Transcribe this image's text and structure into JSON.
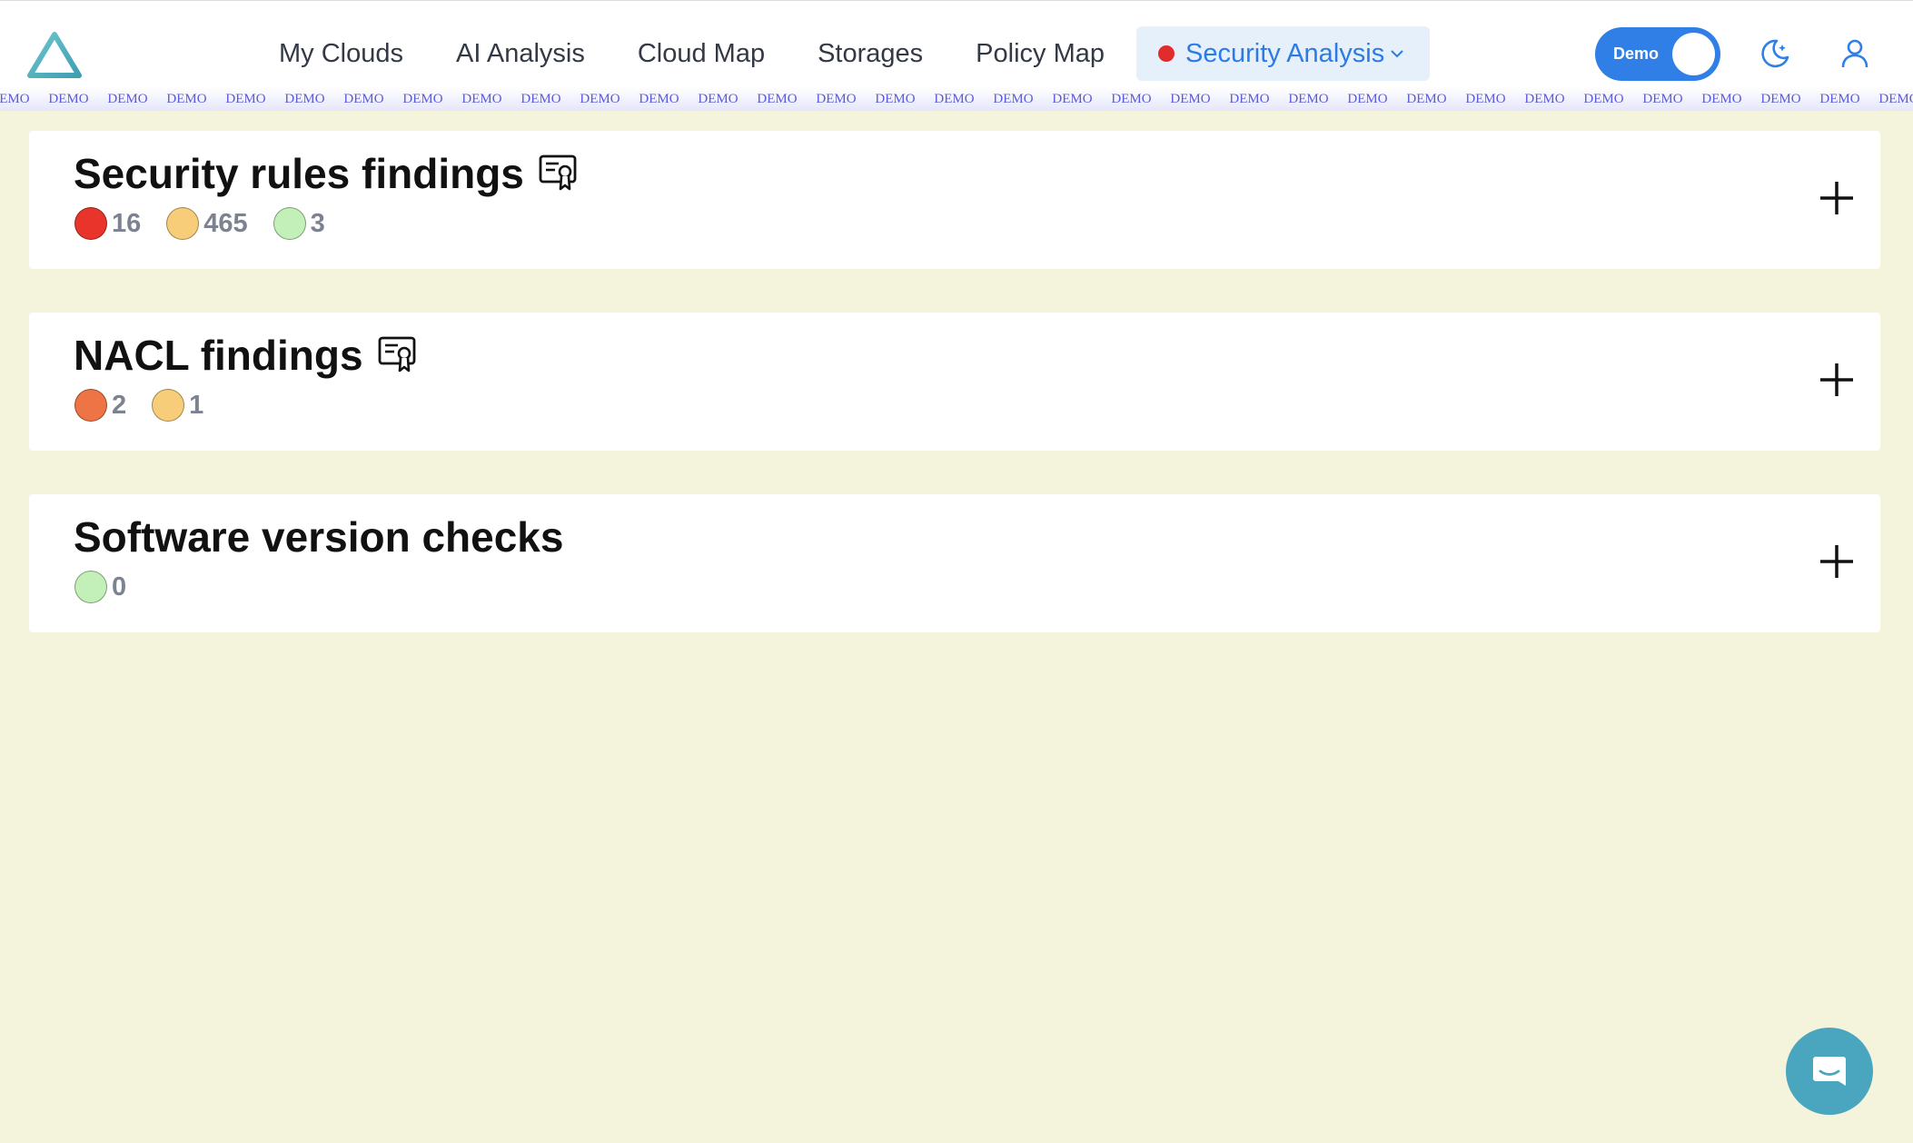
{
  "nav": {
    "items": [
      "My Clouds",
      "AI Analysis",
      "Cloud Map",
      "Storages",
      "Policy Map"
    ],
    "active": "Security Analysis"
  },
  "toggle": {
    "label": "Demo",
    "on": true
  },
  "watermark_text": "DEMO",
  "cards": [
    {
      "title": "Security rules findings",
      "has_cert_icon": true,
      "badges": [
        {
          "color": "#e8342a",
          "count": "16"
        },
        {
          "color": "#f7cd7a",
          "count": "465"
        },
        {
          "color": "#c3f0b8",
          "count": "3"
        }
      ]
    },
    {
      "title": "NACL findings",
      "has_cert_icon": true,
      "badges": [
        {
          "color": "#ee7345",
          "count": "2"
        },
        {
          "color": "#f7cd7a",
          "count": "1"
        }
      ]
    },
    {
      "title": "Software version checks",
      "has_cert_icon": false,
      "badges": [
        {
          "color": "#c3f0b8",
          "count": "0"
        }
      ]
    }
  ],
  "colors": {
    "page_bg": "#f4f4dc",
    "accent": "#2f7fe6",
    "chat": "#4aa6bf"
  }
}
